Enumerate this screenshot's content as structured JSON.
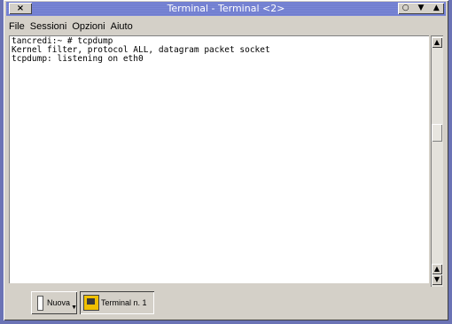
{
  "window": {
    "title": "Terminal - Terminal <2>",
    "close_glyph": "×",
    "buttons": [
      "○",
      "▼",
      "▲"
    ]
  },
  "menu": {
    "items": [
      "File",
      "Sessioni",
      "Opzioni",
      "Aiuto"
    ]
  },
  "terminal": {
    "lines": [
      "tancredi:~ # tcpdump",
      "Kernel filter, protocol ALL, datagram packet socket",
      "tcpdump: listening on eth0"
    ]
  },
  "scrollbar": {
    "up": "▲",
    "down": "▼"
  },
  "tabs": {
    "new_label": "Nuova",
    "session_label": "Terminal n. 1"
  }
}
